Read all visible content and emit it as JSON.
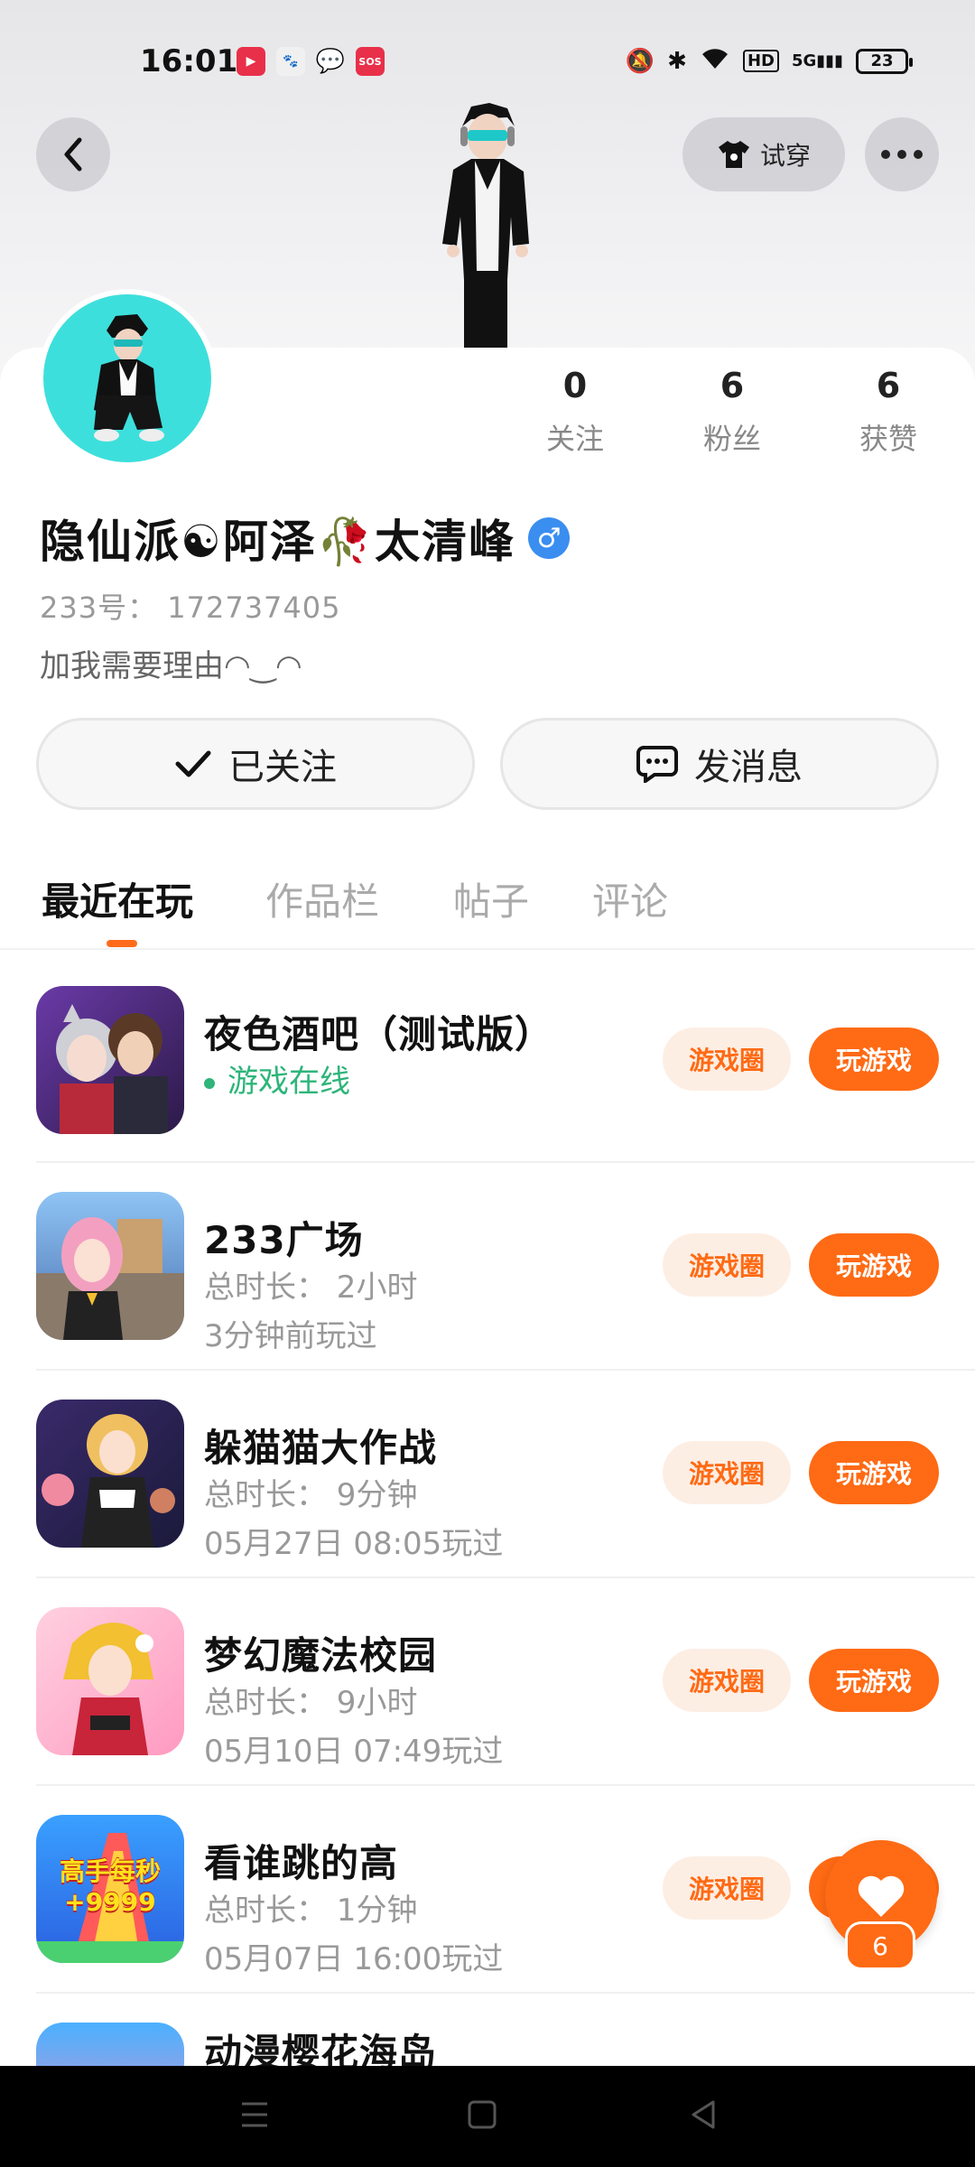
{
  "status_bar": {
    "time": "16:01",
    "battery": "23",
    "network": "5G"
  },
  "header": {
    "tryon_label": "试穿"
  },
  "profile": {
    "name": "隐仙派☯阿泽🥀太清峰",
    "gender_symbol": "♂",
    "uid": "233号： 172737405",
    "bio": "加我需要理由◠‿◠",
    "stats": [
      {
        "num": "0",
        "label": "关注"
      },
      {
        "num": "6",
        "label": "粉丝"
      },
      {
        "num": "6",
        "label": "获赞"
      }
    ],
    "follow_label": "已关注",
    "message_label": "发消息"
  },
  "tabs": [
    {
      "label": "最近在玩"
    },
    {
      "label": "作品栏"
    },
    {
      "label": "帖子"
    },
    {
      "label": "评论"
    }
  ],
  "games": [
    {
      "title": "夜色酒吧（测试版）",
      "meta1": "游戏在线",
      "meta2": "",
      "circle": "游戏圈",
      "play": "玩游戏"
    },
    {
      "title": "233广场",
      "meta1": "总时长： 2小时",
      "meta2": "3分钟前玩过",
      "circle": "游戏圈",
      "play": "玩游戏"
    },
    {
      "title": "躲猫猫大作战",
      "meta1": "总时长： 9分钟",
      "meta2": "05月27日 08:05玩过",
      "circle": "游戏圈",
      "play": "玩游戏"
    },
    {
      "title": "梦幻魔法校园",
      "meta1": "总时长： 9小时",
      "meta2": "05月10日 07:49玩过",
      "circle": "游戏圈",
      "play": "玩游戏"
    },
    {
      "title": "看谁跳的高",
      "meta1": "总时长： 1分钟",
      "meta2": "05月07日 16:00玩过",
      "circle": "游戏圈",
      "play": "玩游戏",
      "icon_text": "高手每秒 +9999"
    },
    {
      "title": "动漫樱花海岛",
      "meta1": "",
      "meta2": "",
      "circle": "",
      "play": ""
    }
  ],
  "fab": {
    "count": "6"
  },
  "colors": {
    "accent": "#ff6a14",
    "online": "#2db57a",
    "gender": "#3a8ef0"
  }
}
